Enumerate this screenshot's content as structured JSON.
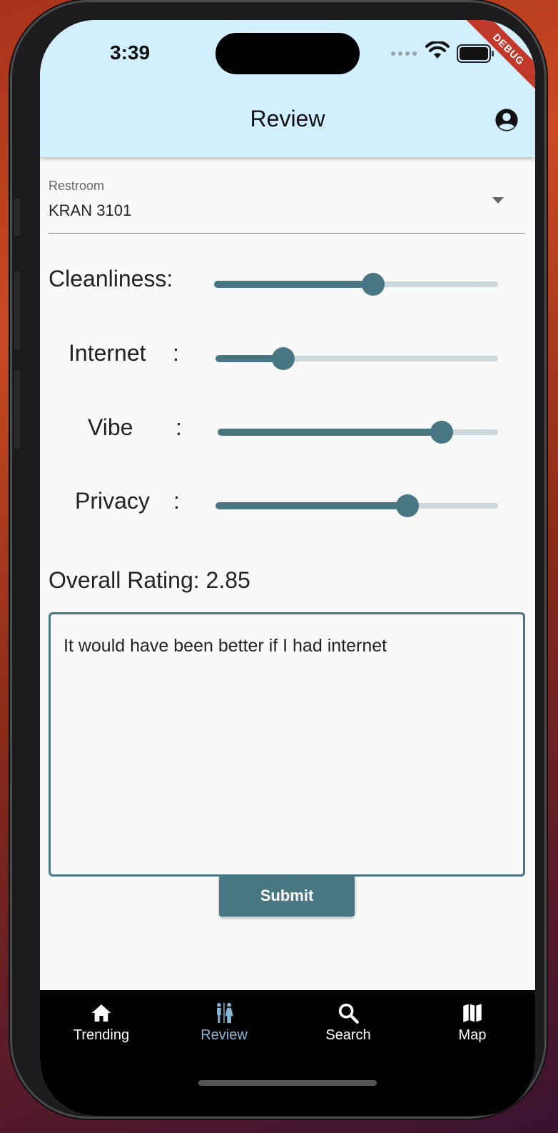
{
  "status_bar": {
    "time": "3:39",
    "debug_banner": "DEBUG"
  },
  "app_bar": {
    "title": "Review",
    "profile_icon": "account-circle-icon"
  },
  "restroom": {
    "label": "Restroom",
    "value": "KRAN 3101"
  },
  "ratings": [
    {
      "label": "Cleanliness:",
      "colon": "",
      "value_fraction": 0.56
    },
    {
      "label": "Internet",
      "colon": ":",
      "value_fraction": 0.24
    },
    {
      "label": "Vibe",
      "colon": ":",
      "value_fraction": 0.8
    },
    {
      "label": "Privacy",
      "colon": ":",
      "value_fraction": 0.68
    }
  ],
  "overall": {
    "text": "Overall Rating: 2.85"
  },
  "review": {
    "text": "It would have been better if I had internet"
  },
  "submit_label": "Submit",
  "nav": [
    {
      "label": "Trending",
      "icon": "home-icon",
      "active": false
    },
    {
      "label": "Review",
      "icon": "restroom-icon",
      "active": true
    },
    {
      "label": "Search",
      "icon": "search-icon",
      "active": false
    },
    {
      "label": "Map",
      "icon": "map-icon",
      "active": false
    }
  ],
  "colors": {
    "app_bar": "#d2efff",
    "accent": "#497683",
    "active_nav": "#87b7d6"
  }
}
